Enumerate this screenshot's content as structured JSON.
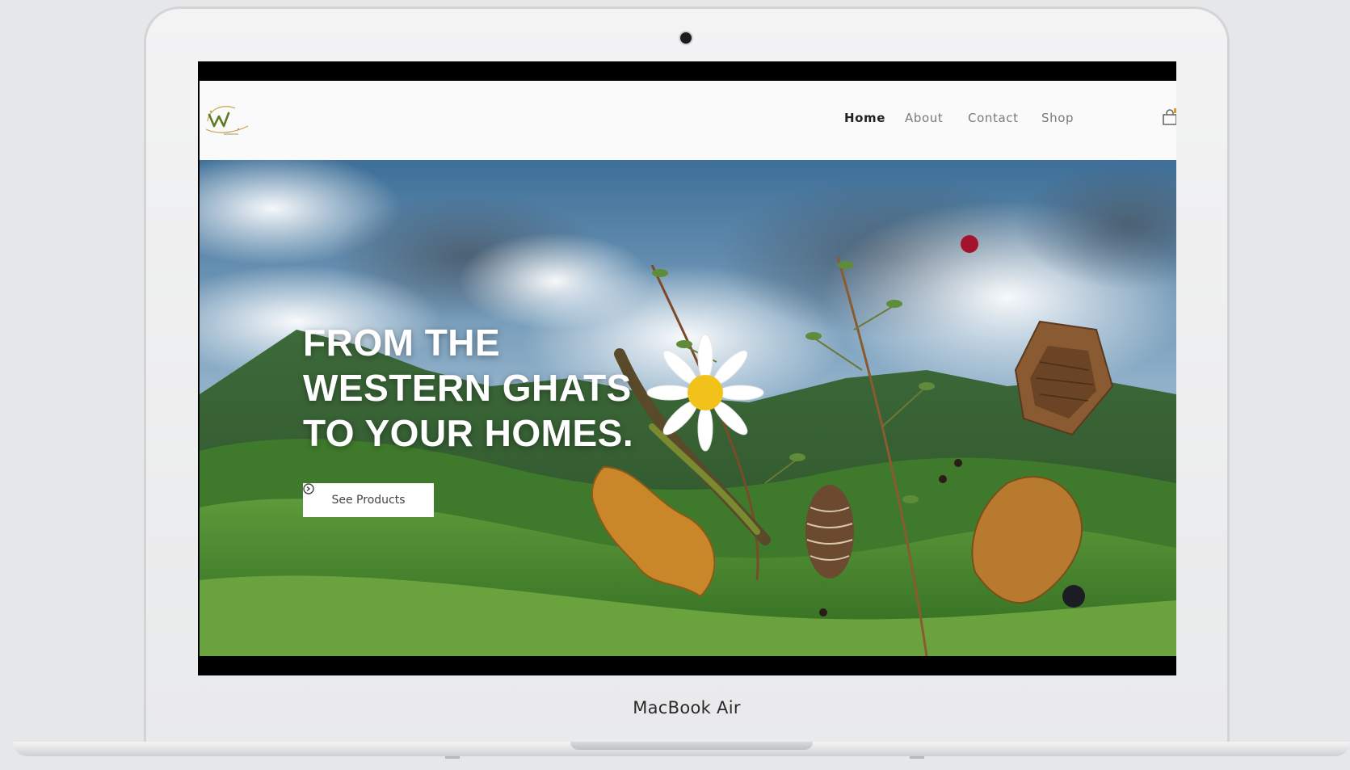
{
  "device": {
    "label": "MacBook Air"
  },
  "site": {
    "nav": {
      "links": [
        {
          "label": "Home",
          "active": true
        },
        {
          "label": "About",
          "active": false
        },
        {
          "label": "Contact",
          "active": false
        },
        {
          "label": "Shop",
          "active": false
        }
      ],
      "cart_icon": "shopping-bag-icon",
      "logo_icon": "brand-logo-w"
    },
    "hero": {
      "headline_lines": [
        "FROM THE",
        "WESTERN GHATS",
        "TO YOUR HOMES."
      ],
      "cta_label": "See Products",
      "cta_icon": "arrow-circle-icon"
    }
  },
  "colors": {
    "accent_green": "#6b8a2e",
    "logo_gold": "#c8a24a",
    "nav_active": "#222222",
    "nav_inactive": "#7a7a7a",
    "sky": "#6f94b5",
    "hills": "#3f7a2c"
  }
}
